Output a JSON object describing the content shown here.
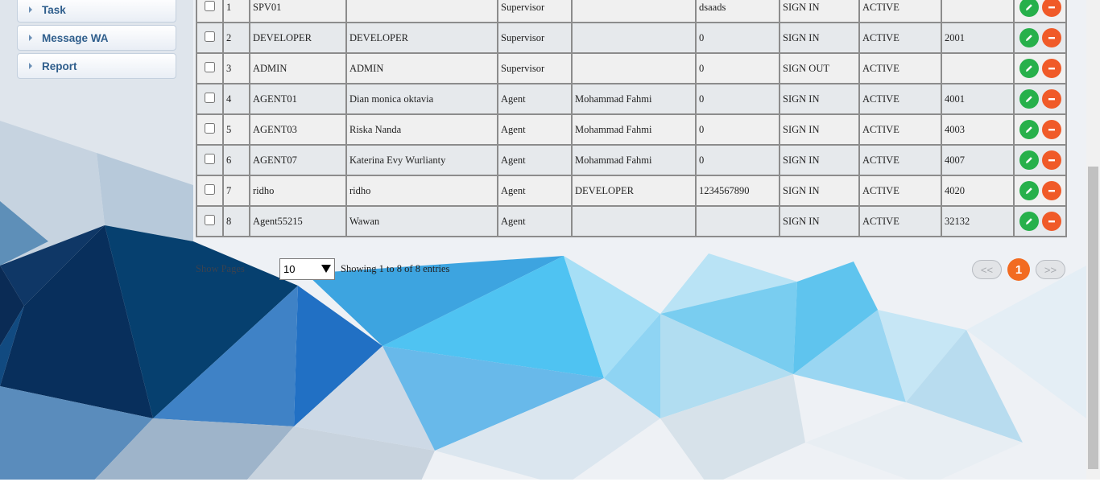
{
  "sidebar": {
    "items": [
      {
        "label": "Task"
      },
      {
        "label": "Message WA"
      },
      {
        "label": "Report"
      }
    ]
  },
  "table": {
    "rows": [
      {
        "no": "1",
        "username": "SPV01",
        "name": "",
        "role": "Supervisor",
        "supervisor": "",
        "phone": "dsaads",
        "status": "SIGN IN",
        "state": "ACTIVE",
        "ext": ""
      },
      {
        "no": "2",
        "username": "DEVELOPER",
        "name": "DEVELOPER",
        "role": "Supervisor",
        "supervisor": "",
        "phone": "0",
        "status": "SIGN IN",
        "state": "ACTIVE",
        "ext": "2001"
      },
      {
        "no": "3",
        "username": "ADMIN",
        "name": "ADMIN",
        "role": "Supervisor",
        "supervisor": "",
        "phone": "0",
        "status": "SIGN OUT",
        "state": "ACTIVE",
        "ext": ""
      },
      {
        "no": "4",
        "username": "AGENT01",
        "name": "Dian monica oktavia",
        "role": "Agent",
        "supervisor": "Mohammad Fahmi",
        "phone": "0",
        "status": "SIGN IN",
        "state": "ACTIVE",
        "ext": "4001"
      },
      {
        "no": "5",
        "username": "AGENT03",
        "name": "Riska Nanda",
        "role": "Agent",
        "supervisor": "Mohammad Fahmi",
        "phone": "0",
        "status": "SIGN IN",
        "state": "ACTIVE",
        "ext": "4003"
      },
      {
        "no": "6",
        "username": "AGENT07",
        "name": "Katerina Evy Wurlianty",
        "role": "Agent",
        "supervisor": "Mohammad Fahmi",
        "phone": "0",
        "status": "SIGN IN",
        "state": "ACTIVE",
        "ext": "4007"
      },
      {
        "no": "7",
        "username": "ridho",
        "name": "ridho",
        "role": "Agent",
        "supervisor": "DEVELOPER",
        "phone": "1234567890",
        "status": "SIGN IN",
        "state": "ACTIVE",
        "ext": "4020"
      },
      {
        "no": "8",
        "username": "Agent55215",
        "name": "Wawan",
        "role": "Agent",
        "supervisor": "",
        "phone": "",
        "status": "SIGN IN",
        "state": "ACTIVE",
        "ext": "32132"
      }
    ],
    "icons": {
      "edit": "pencil-icon",
      "delete": "minus-icon"
    },
    "colors": {
      "edit": "#27b04b",
      "delete": "#f05a28"
    }
  },
  "footer": {
    "show_label": "Show Pages",
    "page_size": "10",
    "showing_text": "Showing 1 to 8 of 8 entries",
    "prev_label": "<<",
    "current_page": "1",
    "next_label": ">>"
  },
  "colors": {
    "accent": "#f26b21"
  }
}
